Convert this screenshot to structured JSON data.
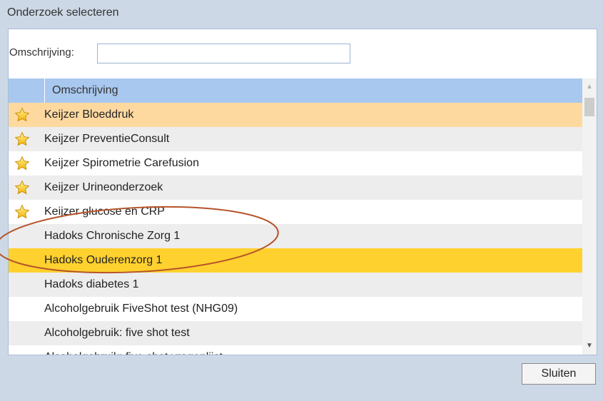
{
  "dialog": {
    "title": "Onderzoek selecteren"
  },
  "search": {
    "label": "Omschrijving:",
    "value": "",
    "placeholder": ""
  },
  "grid": {
    "column_header": "Omschrijving",
    "rows": [
      {
        "label": "Keijzer Bloeddruk",
        "favorite": true,
        "state": "selected-light"
      },
      {
        "label": "Keijzer PreventieConsult",
        "favorite": true,
        "state": "normal"
      },
      {
        "label": "Keijzer Spirometrie Carefusion",
        "favorite": true,
        "state": "normal"
      },
      {
        "label": "Keijzer Urineonderzoek",
        "favorite": true,
        "state": "normal"
      },
      {
        "label": "Keijzer glucose en CRP",
        "favorite": true,
        "state": "normal"
      },
      {
        "label": "Hadoks Chronische Zorg 1",
        "favorite": false,
        "state": "normal"
      },
      {
        "label": "Hadoks Ouderenzorg 1",
        "favorite": false,
        "state": "selected-strong"
      },
      {
        "label": "Hadoks diabetes 1",
        "favorite": false,
        "state": "normal"
      },
      {
        "label": "Alcoholgebruik FiveShot test (NHG09)",
        "favorite": false,
        "state": "normal"
      },
      {
        "label": "Alcoholgebruik: five shot test",
        "favorite": false,
        "state": "normal"
      },
      {
        "label": "Alcoholgebruik: five shot vragenlijst",
        "favorite": false,
        "state": "normal"
      }
    ]
  },
  "icons": {
    "favorite": "star-icon",
    "scroll_up": "arrow-up-icon",
    "scroll_down": "arrow-down-icon"
  },
  "footer": {
    "close_label": "Sluiten"
  },
  "colors": {
    "dialog_bg": "#cdd8e6",
    "header_bg": "#a9c8ef",
    "selected_light": "#fdd9a0",
    "selected_strong": "#ffd12e",
    "annotation": "#b5532a"
  }
}
